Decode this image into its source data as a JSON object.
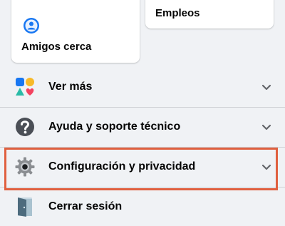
{
  "shortcuts": {
    "friends_nearby": {
      "label": "Amigos cerca",
      "icon": "friends-nearby-icon"
    },
    "jobs": {
      "label": "Empleos"
    }
  },
  "menu": {
    "see_more": {
      "label": "Ver más",
      "icon": "shapes-icon"
    },
    "help": {
      "label": "Ayuda y soporte técnico",
      "icon": "question-icon"
    },
    "settings": {
      "label": "Configuración y privacidad",
      "icon": "gear-icon"
    },
    "logout": {
      "label": "Cerrar sesión",
      "icon": "door-icon"
    }
  },
  "colors": {
    "highlight_border": "#e0603f",
    "friends_icon": "#1877f2",
    "background": "#f0f2f5"
  }
}
